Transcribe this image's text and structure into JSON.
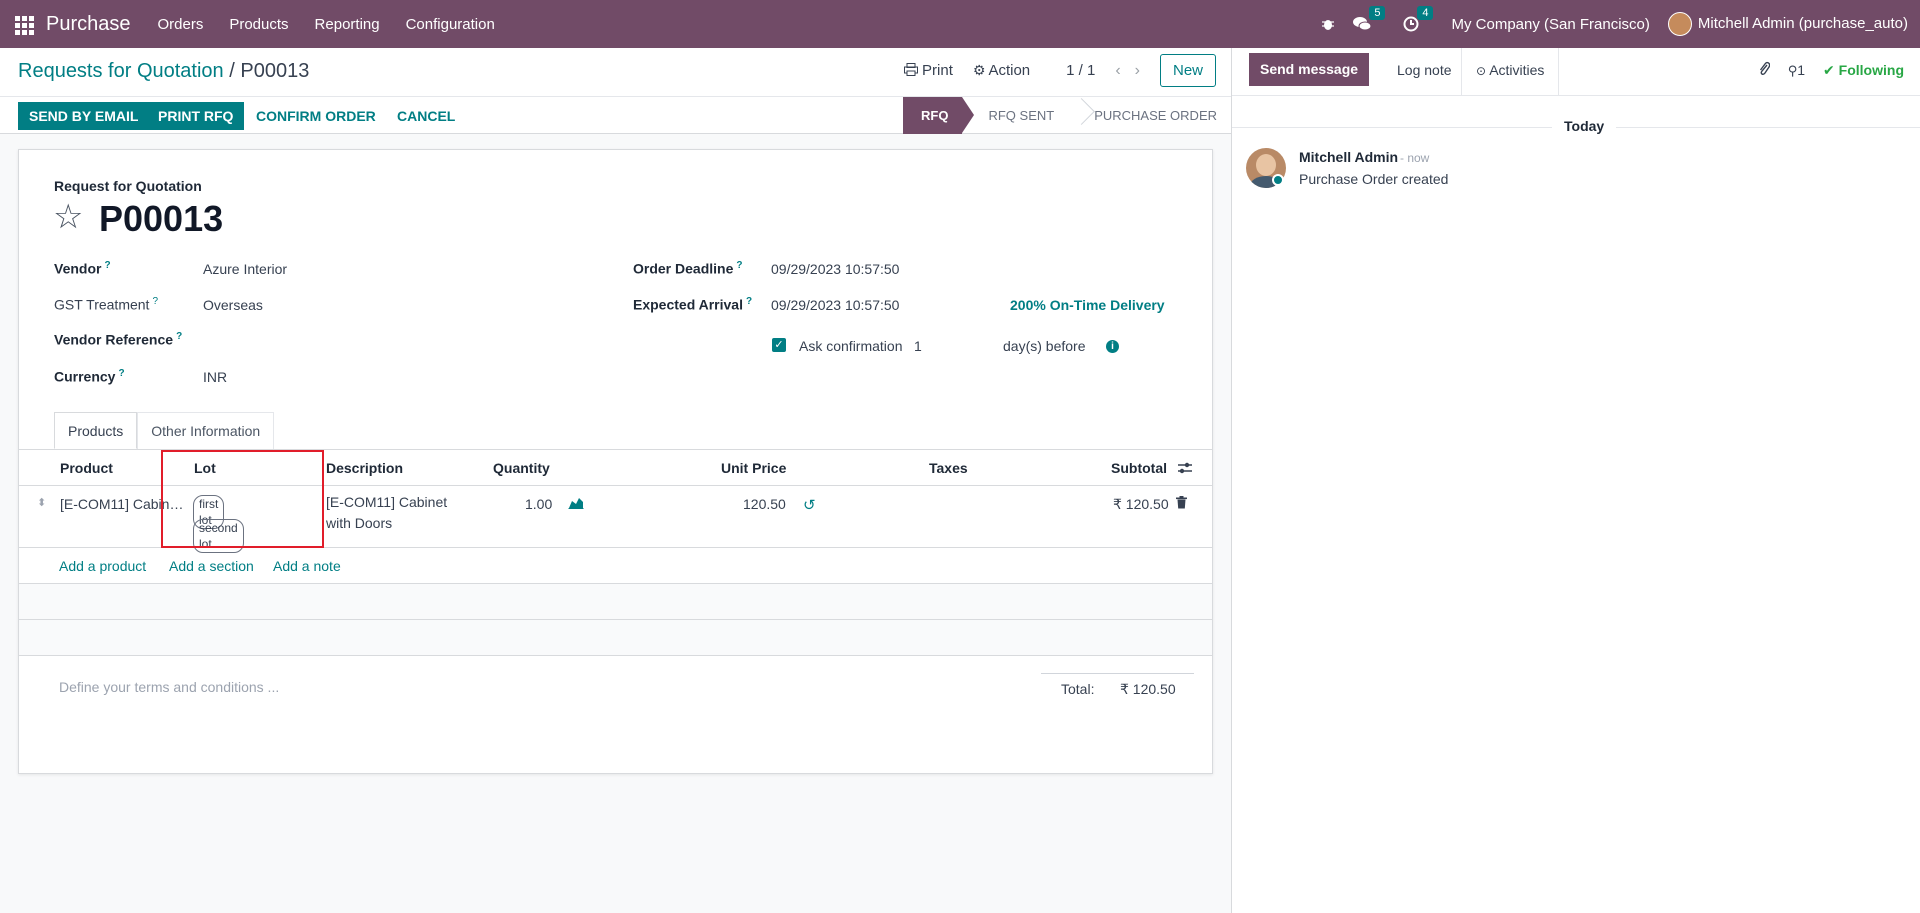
{
  "topbar": {
    "app_name": "Purchase",
    "menu": [
      "Orders",
      "Products",
      "Reporting",
      "Configuration"
    ],
    "messages_count": "5",
    "activities_count": "4",
    "company": "My Company (San Francisco)",
    "user": "Mitchell Admin (purchase_auto)"
  },
  "breadcrumb": {
    "parent": "Requests for Quotation",
    "separator": "/",
    "current": "P00013"
  },
  "control": {
    "print": "Print",
    "action": "Action",
    "pager": "1 / 1",
    "new": "New"
  },
  "statusbar": {
    "send_by_email": "SEND BY EMAIL",
    "print_rfq": "PRINT RFQ",
    "confirm_order": "CONFIRM ORDER",
    "cancel": "CANCEL",
    "stages": [
      "RFQ",
      "RFQ SENT",
      "PURCHASE ORDER"
    ]
  },
  "form": {
    "header_label": "Request for Quotation",
    "name": "P00013",
    "vendor_label": "Vendor",
    "vendor": "Azure Interior",
    "gst_label": "GST Treatment",
    "gst": "Overseas",
    "vendor_ref_label": "Vendor Reference",
    "currency_label": "Currency",
    "currency": "INR",
    "deadline_label": "Order Deadline",
    "deadline": "09/29/2023 10:57:50",
    "arrival_label": "Expected Arrival",
    "arrival": "09/29/2023 10:57:50",
    "on_time": "200% On-Time Delivery",
    "ask_confirmation": "Ask confirmation",
    "days_value": "1",
    "days_before": "day(s) before",
    "tooltip_mark": "?"
  },
  "tabs": [
    "Products",
    "Other Information"
  ],
  "table": {
    "headers": [
      "Product",
      "Lot",
      "Description",
      "Quantity",
      "Unit Price",
      "Taxes",
      "Subtotal"
    ],
    "row": {
      "product": "[E-COM11] Cabin…",
      "lots": [
        "first lot",
        "second lot"
      ],
      "description_1": "[E-COM11] Cabinet",
      "description_2": "with Doors",
      "quantity": "1.00",
      "unit_price": "120.50",
      "subtotal": "₹ 120.50"
    },
    "add_product": "Add a product",
    "add_section": "Add a section",
    "add_note": "Add a note"
  },
  "footer": {
    "terms_placeholder": "Define your terms and conditions ...",
    "total_label": "Total:",
    "total": "₹ 120.50"
  },
  "chatter": {
    "send_message": "Send message",
    "log_note": "Log note",
    "activities": "Activities",
    "followers": "1",
    "following": "Following",
    "today": "Today",
    "author": "Mitchell Admin",
    "time": "- now",
    "body": "Purchase Order created"
  },
  "colors": {
    "brand": "#714b67",
    "accent": "#017e84",
    "highlight_box": "#e11d2a"
  }
}
